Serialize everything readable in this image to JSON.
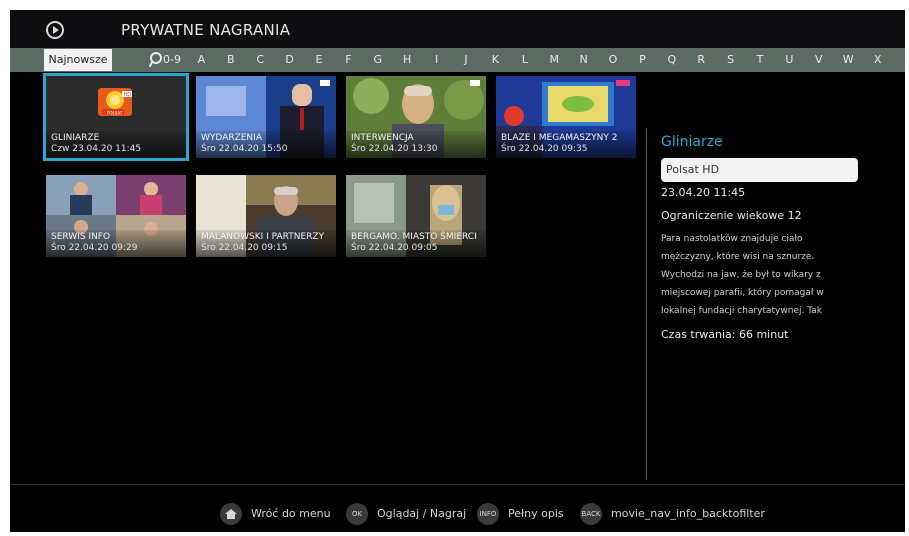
{
  "header": {
    "title": "PRYWATNE NAGRANIA",
    "icon": "play-circle-icon"
  },
  "alphabar": {
    "selected": "Najnowsze",
    "letters": [
      "0-9",
      "A",
      "B",
      "C",
      "D",
      "E",
      "F",
      "G",
      "H",
      "I",
      "J",
      "K",
      "L",
      "M",
      "N",
      "O",
      "P",
      "Q",
      "R",
      "S",
      "T",
      "U",
      "V",
      "W",
      "X"
    ]
  },
  "recordings": [
    {
      "title": "GLINIARZE",
      "date": "Czw 23.04.20 11:45"
    },
    {
      "title": "WYDARZENIA",
      "date": "Śro 22.04.20 15:50"
    },
    {
      "title": "INTERWENCJA",
      "date": "Śro 22.04.20 13:30"
    },
    {
      "title": "BLAZE I MEGAMASZYNY 2",
      "date": "Śro 22.04.20 09:35"
    },
    {
      "title": "SERWIS INFO",
      "date": "Śro 22.04.20 09:29"
    },
    {
      "title": "MALANOWSKI I PARTNERZY",
      "date": "Śro 22.04.20 09:15"
    },
    {
      "title": "BERGAMO. MIASTO ŚMIERCI",
      "date": "Śro 22.04.20 09:05"
    }
  ],
  "logo": {
    "text": "POLSAT",
    "badge": "HD"
  },
  "detail": {
    "title": "Gliniarze",
    "channel": "Polsat HD",
    "datetime": "23.04.20 11:45",
    "age": "Ograniczenie wiekowe 12",
    "description": "Para nastolatków znajduje ciało mężczyzny, które wisi na sznurze. Wychodzi na jaw, że był to wikary z miejscowej parafii, który pomagał w lokalnej fundacji charytatywnej. Tak",
    "duration": "Czas trwania: 66 minut"
  },
  "footer": {
    "items": [
      {
        "key": "home-icon",
        "label": "Wróć do menu"
      },
      {
        "key": "OK",
        "label": "Oglądaj / Nagraj"
      },
      {
        "key": "INFO",
        "label": "Pełny opis"
      },
      {
        "key": "BACK",
        "label": "movie_nav_info_backtofilter"
      }
    ]
  },
  "colors": {
    "accent": "#2aa6d2",
    "alphabar": "#5b6b64",
    "background": "#000000"
  }
}
